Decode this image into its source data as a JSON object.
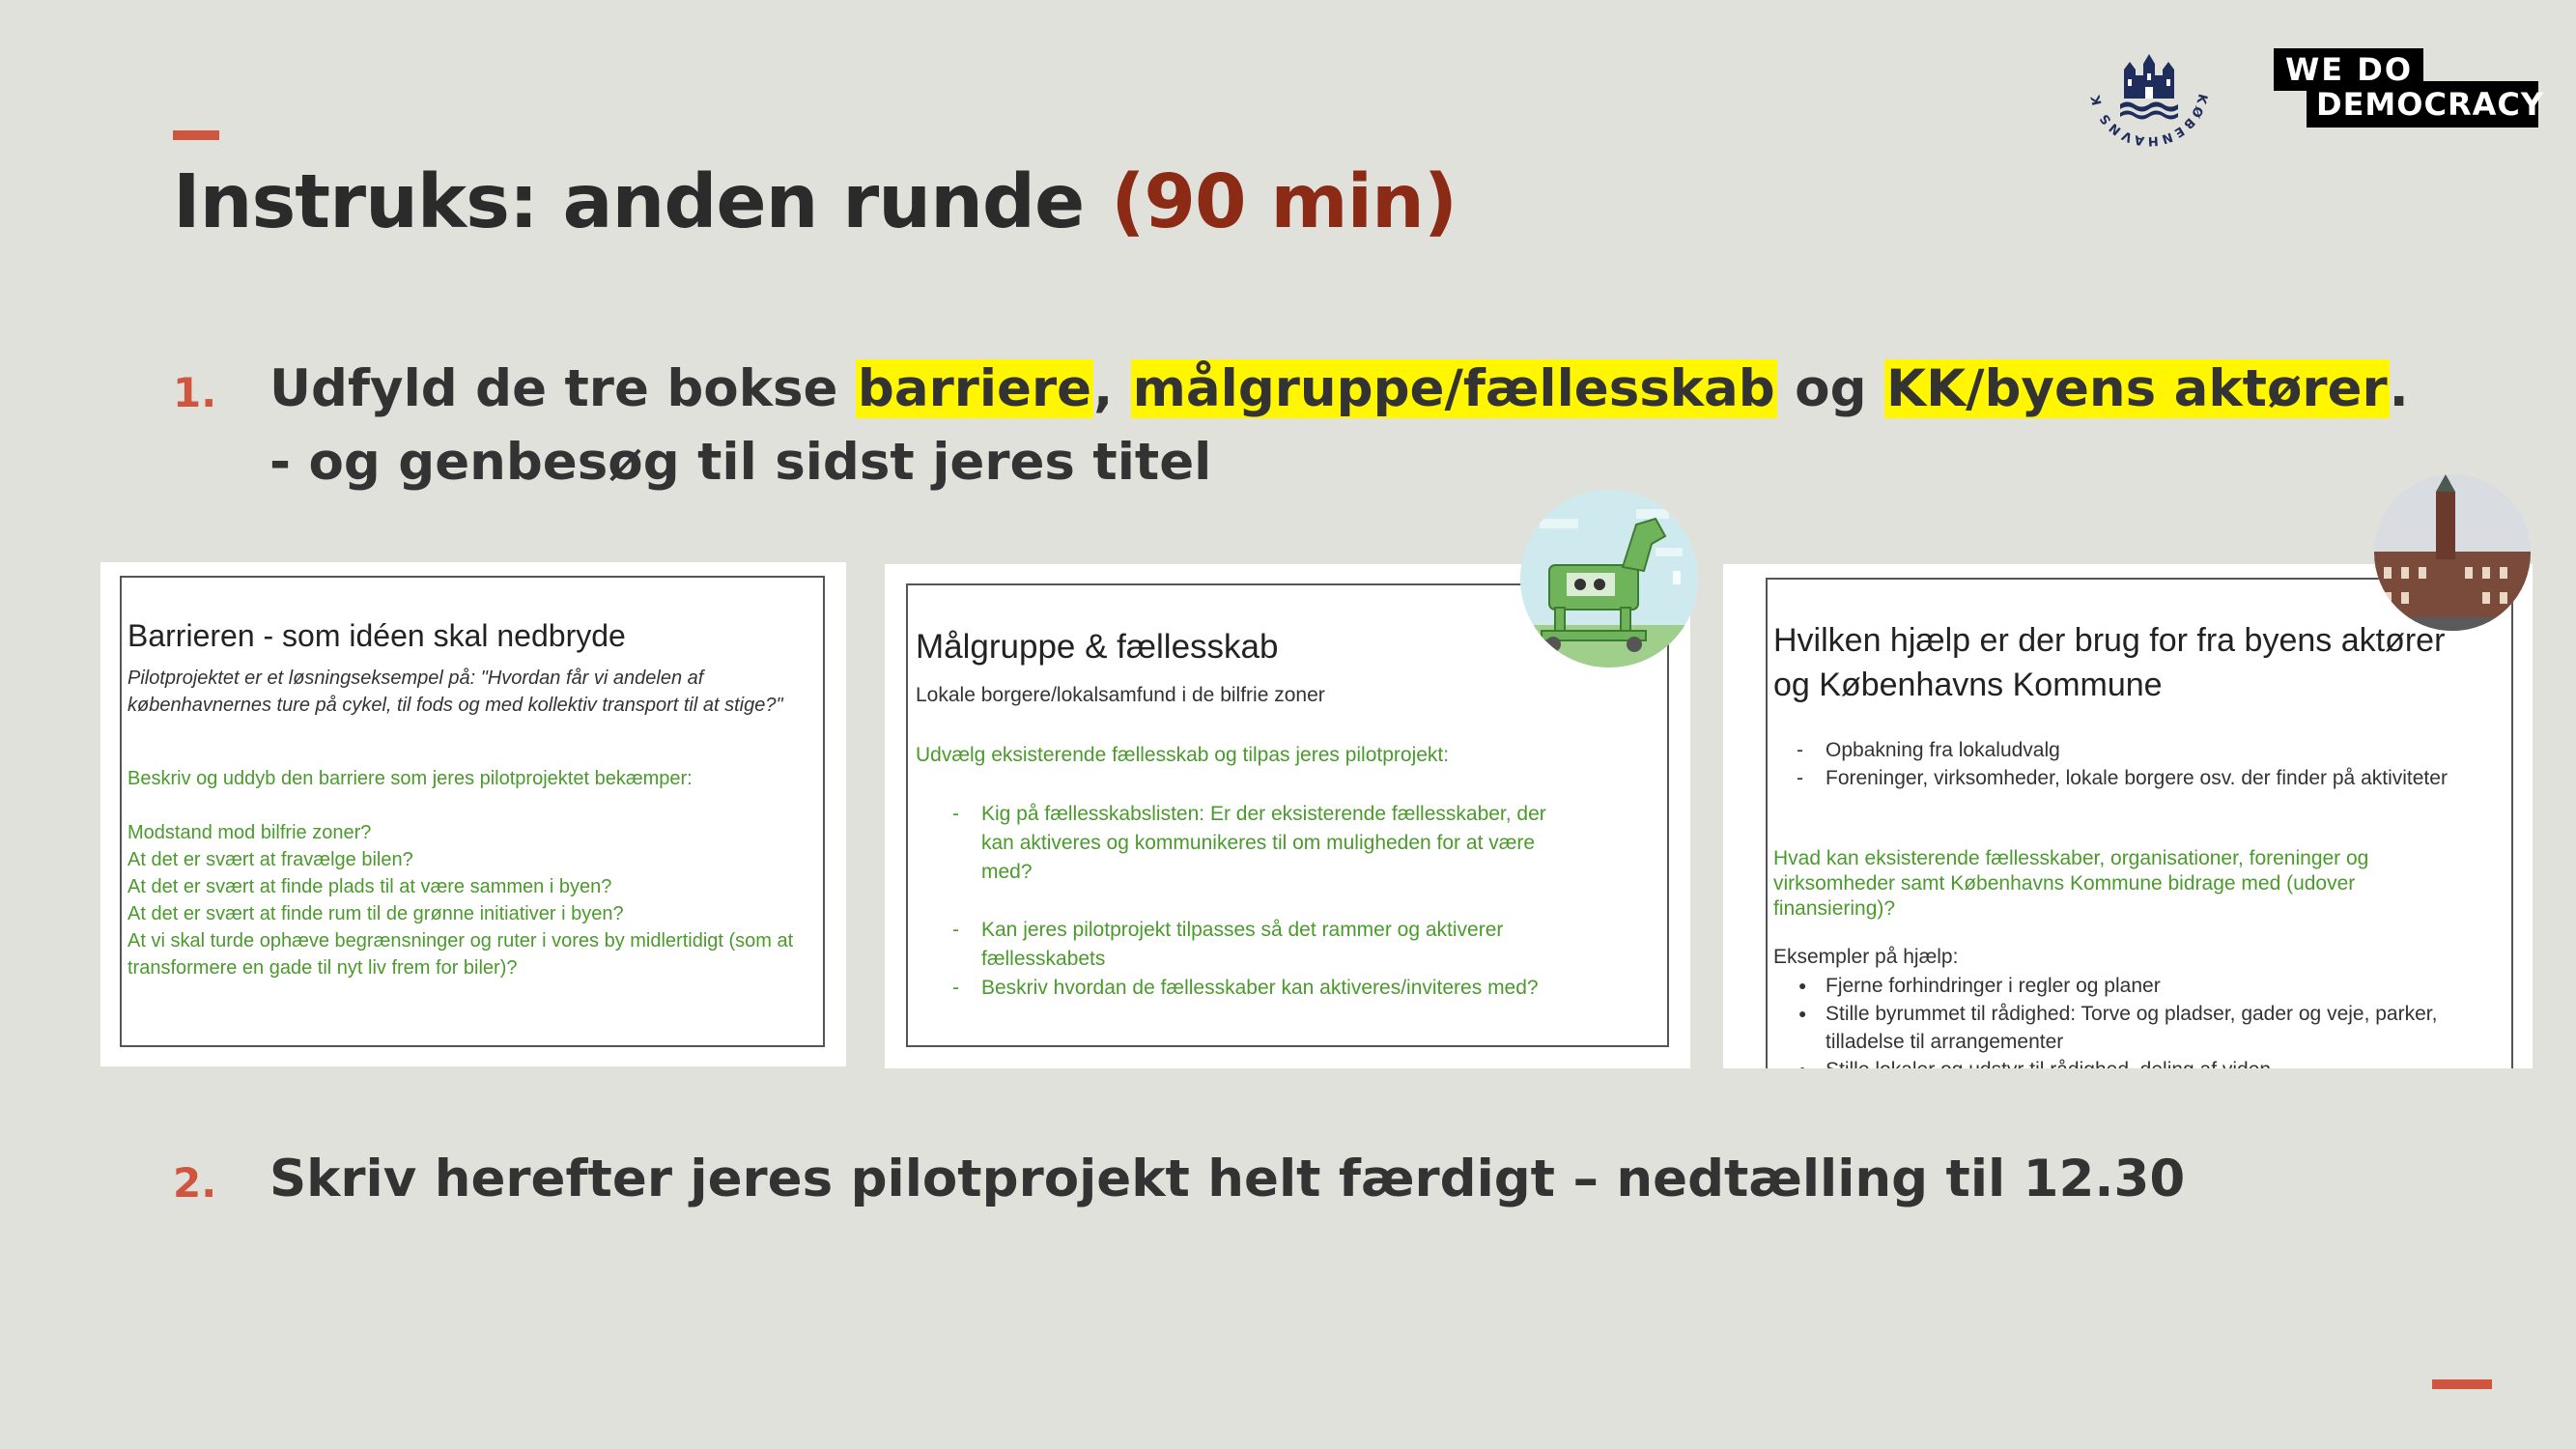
{
  "slide": {
    "title": "Instruks: anden runde",
    "duration": "(90 min)"
  },
  "logos": {
    "kbh_text": "KØBENHAVNS KOMMUNE",
    "wdd_line1": "WE  DO",
    "wdd_line2": "DEMOCRACY"
  },
  "step1": {
    "number": "1.",
    "prefix": "Udfyld de tre bokse ",
    "hl1": "barriere",
    "sep1": ", ",
    "hl2": "målgruppe/fællesskab",
    "sep2": " og ",
    "hl3": "KK/byens aktører",
    "suffix": ".",
    "line2": "- og genbesøg til sidst jeres titel"
  },
  "step2": {
    "number": "2.",
    "text": "Skriv herefter jeres pilotprojekt helt færdigt – nedtælling til 12.30"
  },
  "card1": {
    "heading": "Barrieren - som idéen skal nedbryde",
    "intro": "Pilotprojektet er et løsningseksempel på: \"Hvordan får vi andelen af københavnernes ture på cykel, til fods og med kollektiv transport til at stige?\"",
    "prompt": "Beskriv og uddyb den barriere som jeres pilotprojektet bekæmper:",
    "lines": [
      "Modstand mod bilfrie zoner?",
      "At det er svært at fravælge bilen?",
      "At det er svært at finde plads til at være sammen i byen?",
      "At det er svært at finde rum til de grønne initiativer i byen?",
      "At vi skal turde ophæve begrænsninger og ruter i vores by midlertidigt (som at transformere en gade til nyt liv frem for biler)?"
    ]
  },
  "card2": {
    "heading": "Målgruppe & fællesskab",
    "subheading": "Lokale borgere/lokalsamfund i de bilfrie zoner",
    "prompt": "Udvælg eksisterende fællesskab og tilpas jeres pilotprojekt:",
    "item1": "Kig på fællesskabslisten: Er der eksisterende fællesskaber, der kan aktiveres og kommunikeres til om muligheden for at være med?",
    "item2": "Kan jeres pilotprojekt tilpasses så det rammer og aktiverer fællesskabets",
    "item3": "Beskriv hvordan de fællesskaber kan aktiveres/inviteres med?"
  },
  "card3": {
    "heading": "Hvilken hjælp er der brug for fra byens aktører og Københavns Kommune",
    "bullets": [
      "Opbakning fra lokaludvalg",
      "Foreninger, virksomheder, lokale borgere osv. der finder på aktiviteter"
    ],
    "question": "Hvad kan eksisterende fællesskaber, organisationer, foreninger og virksomheder samt Københavns Kommune bidrage med (udover finansiering)?",
    "examples_label": "Eksempler på hjælp:",
    "examples": [
      "Fjerne forhindringer i regler og planer",
      "Stille byrummet til rådighed: Torve og pladser, gader og veje, parker, tilladelse til arrangementer",
      "Stille lokaler og udstyr til rådighed, deling af viden"
    ]
  },
  "colors": {
    "background": "#e1e1dc",
    "accent": "#d0553f",
    "duration": "#8b2a15",
    "highlight": "#fff600",
    "card_green": "#4a9a2c"
  }
}
